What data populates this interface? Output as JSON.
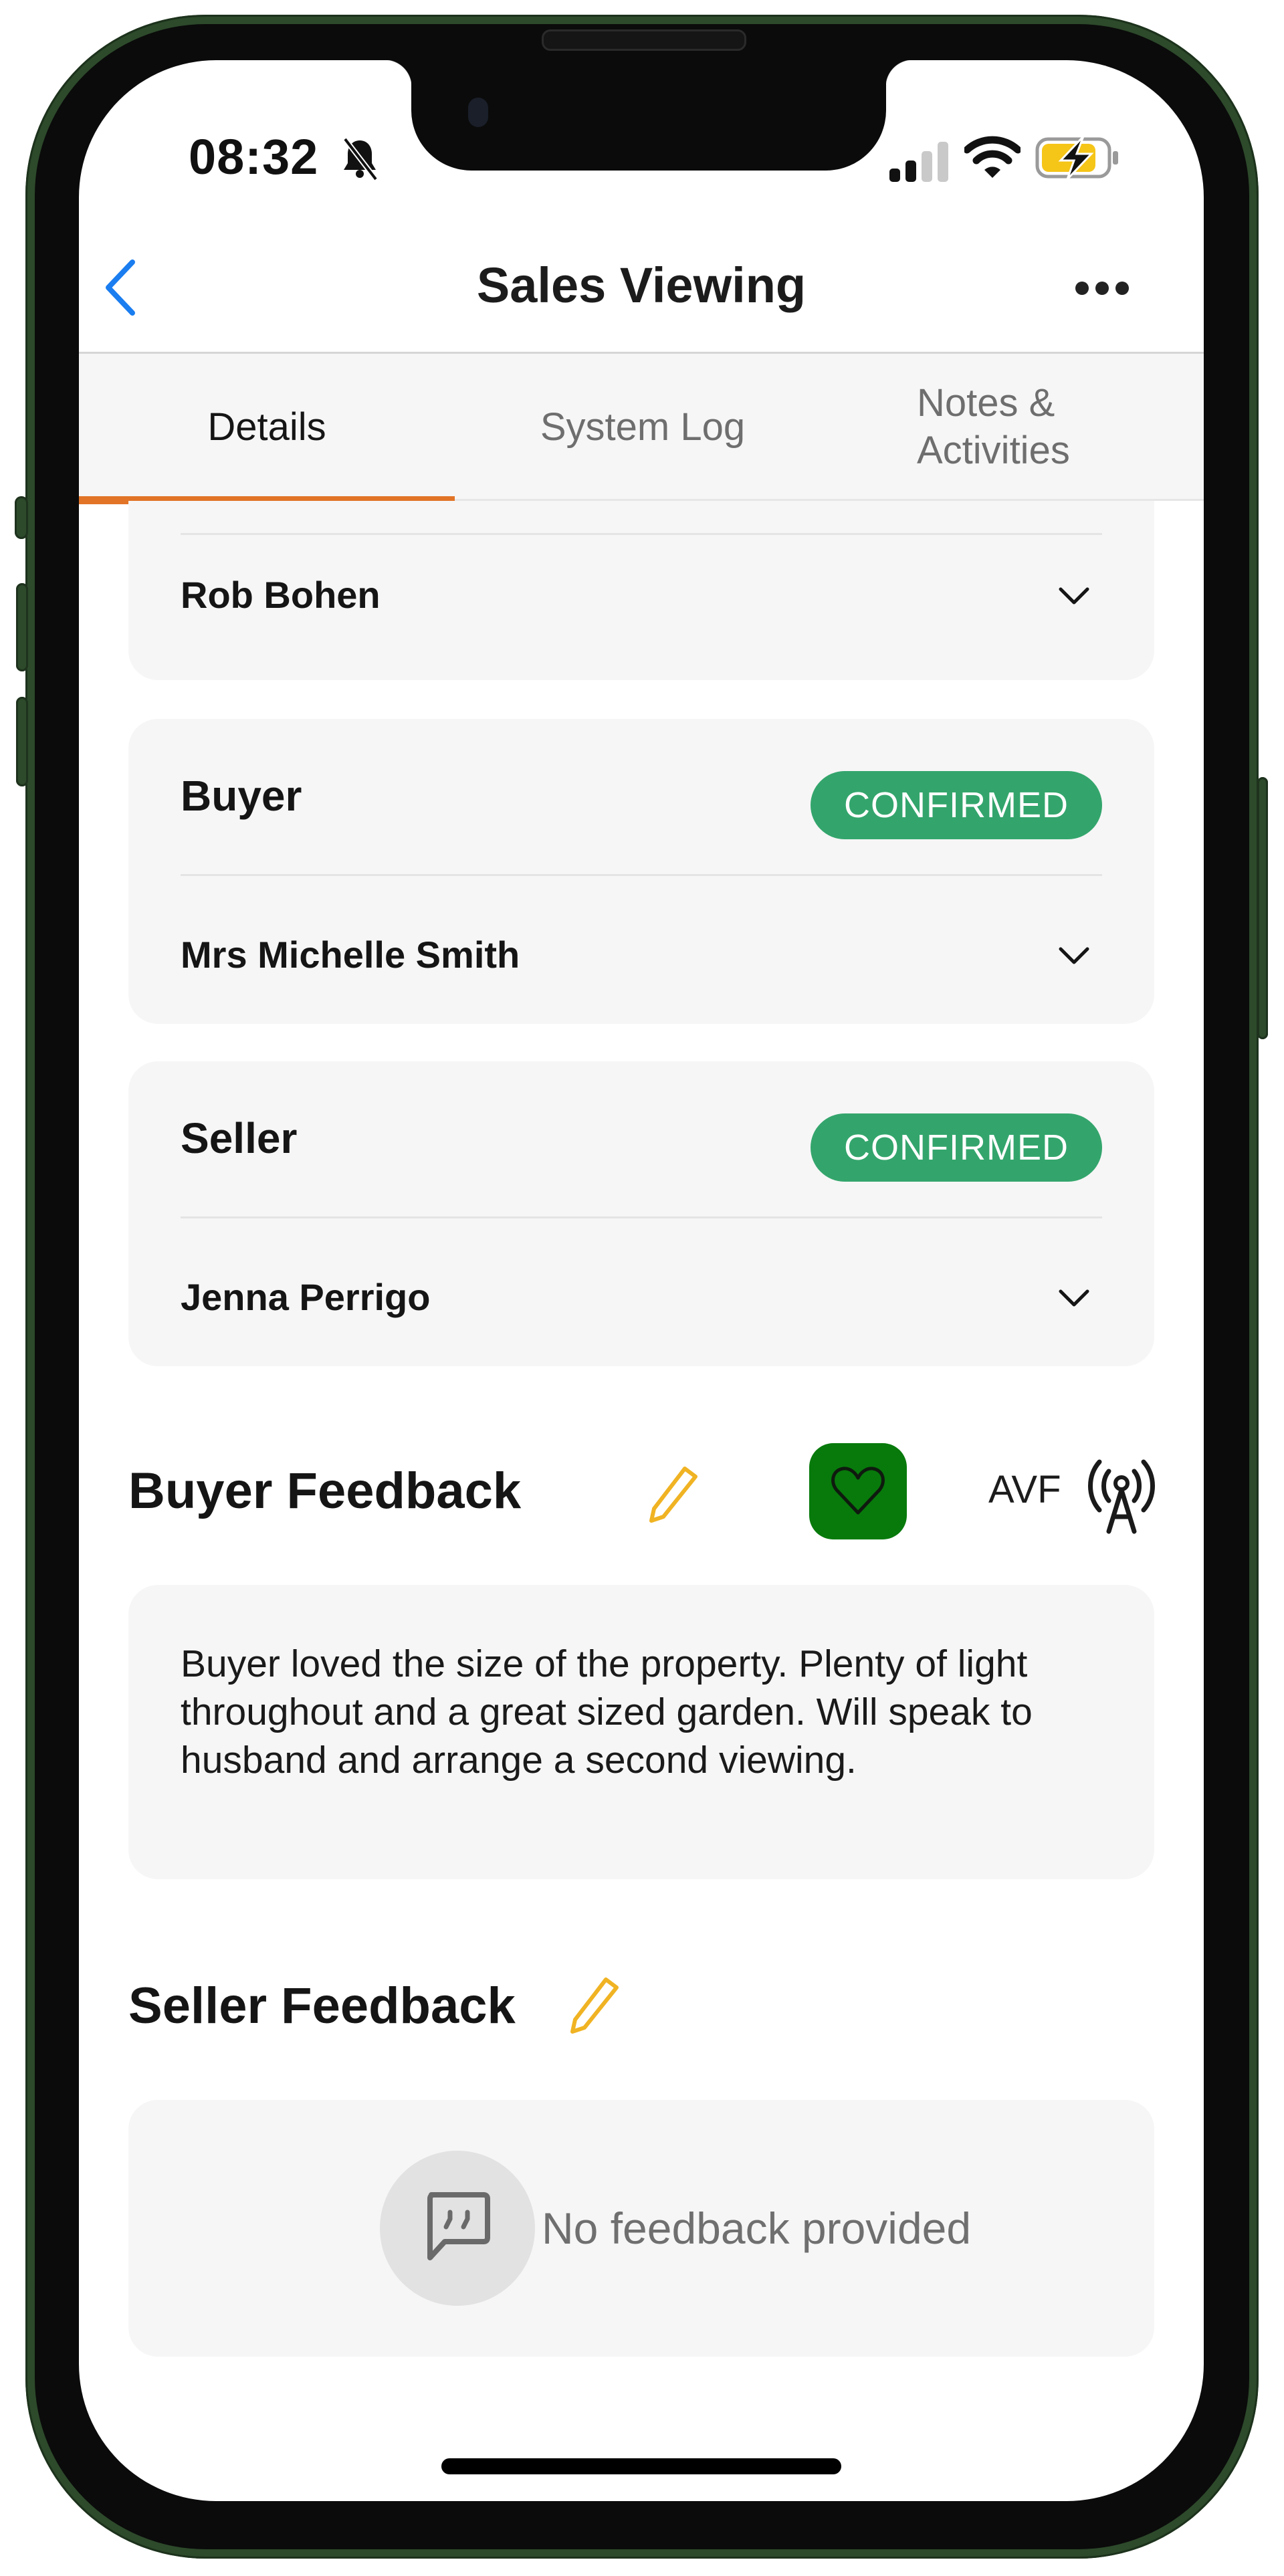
{
  "status_bar": {
    "time": "08:32",
    "icons": [
      "bell-slash-icon",
      "cellular-signal-icon",
      "wifi-icon",
      "battery-charging-icon"
    ],
    "signal_bars_active": 2,
    "signal_bars_total": 4,
    "battery_color": "#f5c518"
  },
  "nav": {
    "back_icon": "chevron-left-icon",
    "title": "Sales Viewing",
    "more_icon": "ellipsis-icon",
    "back_color": "#1a7df0"
  },
  "tabs": [
    {
      "label": "Details",
      "active": true
    },
    {
      "label": "System Log",
      "active": false
    },
    {
      "label": "Notes & Activities",
      "active": false
    }
  ],
  "tab_accent": "#e27427",
  "parties": [
    {
      "heading": null,
      "name": "Rob Bohen",
      "status": null
    },
    {
      "heading": "Buyer",
      "name": "Mrs Michelle Smith",
      "status": "CONFIRMED"
    },
    {
      "heading": "Seller",
      "name": "Jenna Perrigo",
      "status": "CONFIRMED"
    }
  ],
  "status_color": "#33a56c",
  "buyer_feedback": {
    "heading": "Buyer Feedback",
    "edit_icon": "pencil-icon",
    "reaction_icon": "heart-icon",
    "reaction_color": "#077a0b",
    "avf_label": "AVF",
    "avf_icon": "antenna-icon",
    "text": "Buyer loved the size of the property. Plenty of light throughout and a great sized garden. Will speak to husband and arrange a second viewing."
  },
  "seller_feedback": {
    "heading": "Seller Feedback",
    "edit_icon": "pencil-icon",
    "empty_icon": "quote-bubble-icon",
    "empty_text": "No feedback provided"
  },
  "edit_color": "#f0b323"
}
